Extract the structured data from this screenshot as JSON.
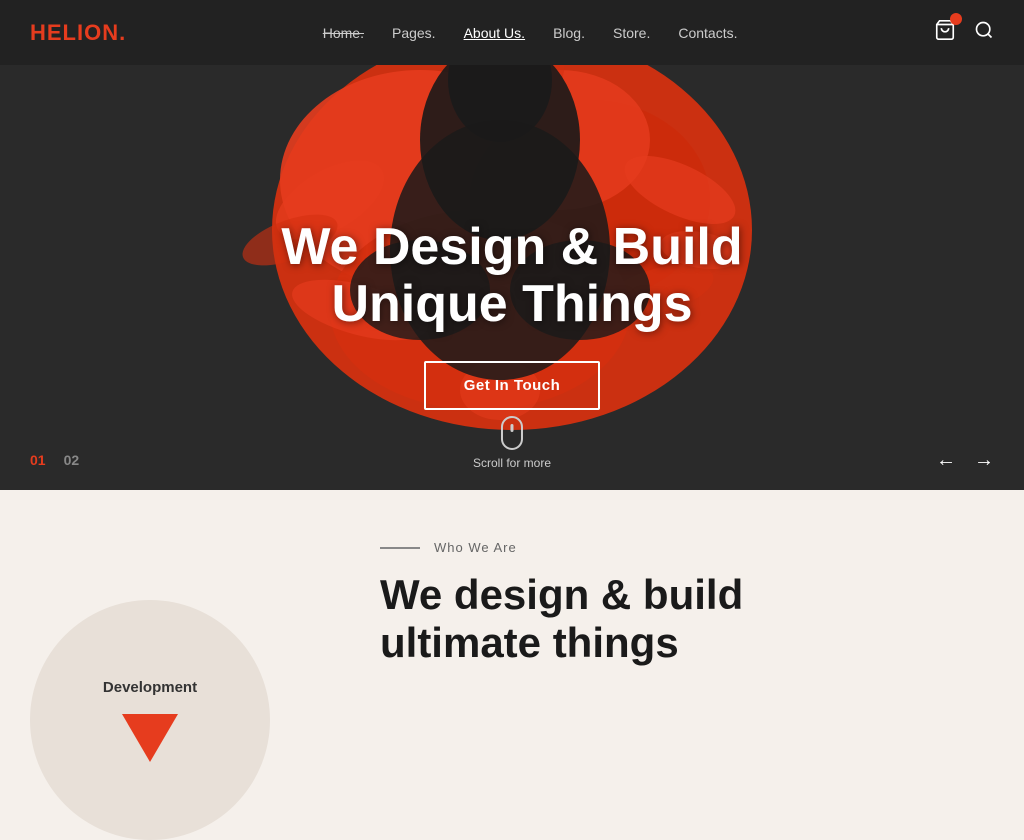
{
  "header": {
    "logo": "HELION",
    "logo_dot": ".",
    "nav": [
      {
        "label": "Home.",
        "state": "strikethrough"
      },
      {
        "label": "Pages.",
        "state": "normal"
      },
      {
        "label": "About Us.",
        "state": "active"
      },
      {
        "label": "Blog.",
        "state": "normal"
      },
      {
        "label": "Store.",
        "state": "normal"
      },
      {
        "label": "Contacts.",
        "state": "normal"
      }
    ],
    "cart_icon": "🛍",
    "search_icon": "🔍"
  },
  "hero": {
    "title_line1": "We Design & Build",
    "title_line2": "Unique Things",
    "cta_label": "Get In Touch",
    "scroll_label": "Scroll for more",
    "slides": [
      "01",
      "02"
    ],
    "active_slide": 0
  },
  "below_hero": {
    "section_tag": "Who We Are",
    "dev_label": "Development",
    "title_line1": "We design & build",
    "title_line2": "ultimate things"
  },
  "colors": {
    "accent": "#e63c1e",
    "hero_bg": "#2a2a2a",
    "section_bg": "#f5f0eb"
  }
}
